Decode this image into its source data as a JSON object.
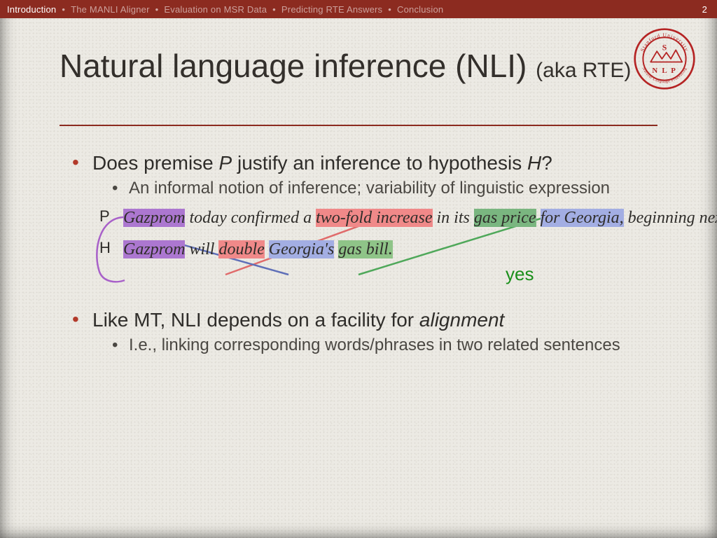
{
  "topbar": {
    "items": [
      {
        "label": "Introduction",
        "active": true
      },
      {
        "label": "The MANLI Aligner",
        "active": false
      },
      {
        "label": "Evaluation on MSR Data",
        "active": false
      },
      {
        "label": "Predicting RTE Answers",
        "active": false
      },
      {
        "label": "Conclusion",
        "active": false
      }
    ],
    "page": "2"
  },
  "title": {
    "main": "Natural language inference (NLI) ",
    "sub": "(aka RTE)"
  },
  "logo": {
    "outer": "Stanford University",
    "inner_top": "S",
    "inner_bot": "N L P",
    "subring": "Natural Language Processing"
  },
  "bullets": [
    {
      "pre": "Does premise ",
      "var1": "P",
      "mid": " justify an inference to hypothesis ",
      "var2": "H",
      "post": "?",
      "sub": [
        "An informal notion of inference; variability of linguistic expression"
      ]
    },
    {
      "pre": "Like MT, NLI depends on a facility for ",
      "ital": "alignment",
      "post": "",
      "sub": [
        "I.e., linking corresponding words/phrases in two related sentences"
      ]
    }
  ],
  "example": {
    "p_label": "P",
    "h_label": "H",
    "p_segments": [
      {
        "t": "Gazprom",
        "c": "hl-purple"
      },
      {
        "t": " today confirmed a ",
        "c": ""
      },
      {
        "t": "two-fold increase",
        "c": "hl-red"
      },
      {
        "t": " in its ",
        "c": ""
      },
      {
        "t": "gas price",
        "c": "hl-green"
      },
      {
        "t": " ",
        "c": ""
      },
      {
        "t": "for Georgia,",
        "c": "hl-lblue"
      },
      {
        "t": " beginning next Monday.",
        "c": ""
      }
    ],
    "h_segments": [
      {
        "t": "Gazprom",
        "c": "hl-purple"
      },
      {
        "t": " will ",
        "c": ""
      },
      {
        "t": "double",
        "c": "hl-red"
      },
      {
        "t": " ",
        "c": ""
      },
      {
        "t": "Georgia's",
        "c": "hl-lblue"
      },
      {
        "t": " ",
        "c": ""
      },
      {
        "t": "gas bill.",
        "c": "hl-lgreen"
      }
    ],
    "verdict": "yes"
  },
  "colors": {
    "accent": "#8c2b20",
    "bullet": "#b23a2a",
    "yes": "#1a8f1a",
    "conn_purple": "#a860c9",
    "conn_red": "#e06b6b",
    "conn_blue": "#5f6fb8",
    "conn_green": "#4fa85a"
  }
}
